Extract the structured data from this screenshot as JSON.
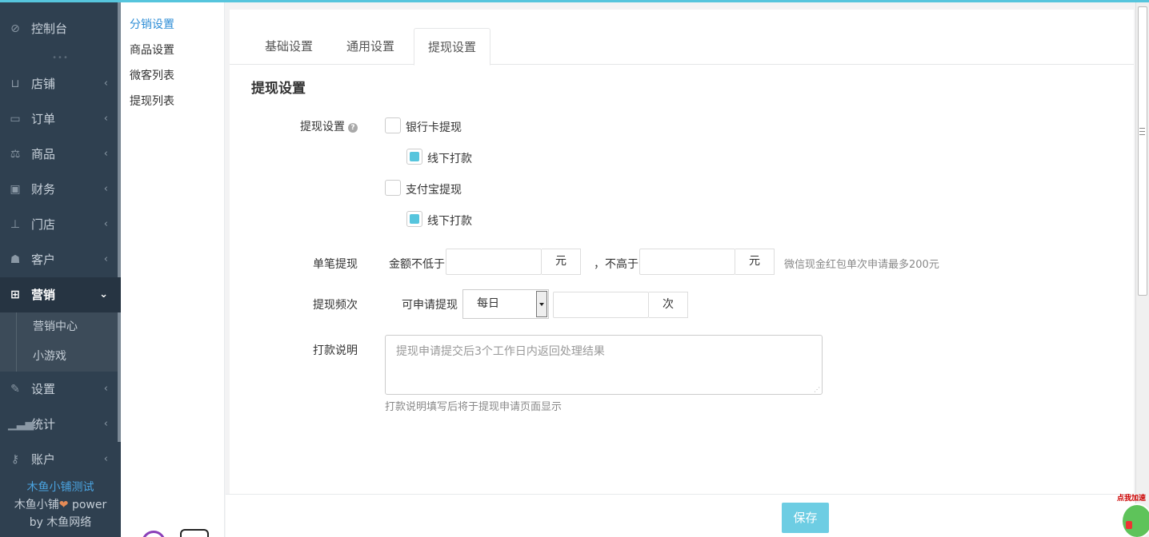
{
  "sidebar": {
    "dashboard": "控制台",
    "items": [
      {
        "label": "店铺",
        "icon": "basket-icon"
      },
      {
        "label": "订单",
        "icon": "money-icon"
      },
      {
        "label": "商品",
        "icon": "scale-icon"
      },
      {
        "label": "财务",
        "icon": "cash-icon"
      },
      {
        "label": "门店",
        "icon": "sitemap-icon"
      },
      {
        "label": "客户",
        "icon": "users-icon"
      },
      {
        "label": "营销",
        "icon": "gift-icon"
      },
      {
        "label": "设置",
        "icon": "wrench-icon"
      },
      {
        "label": "统计",
        "icon": "signal-icon"
      },
      {
        "label": "账户",
        "icon": "key-icon"
      }
    ],
    "marketing_sub": [
      "营销中心",
      "小游戏"
    ],
    "brand_line1": "木鱼小铺测试",
    "brand_line2_a": "木鱼小铺",
    "brand_line2_heart": "❤",
    "brand_line2_b": " power",
    "brand_line3": "by 木鱼网络"
  },
  "submenu": [
    "分销设置",
    "商品设置",
    "微客列表",
    "提现列表"
  ],
  "tabs": [
    "基础设置",
    "通用设置",
    "提现设置"
  ],
  "section_title": "提现设置",
  "form": {
    "withdraw_label": "提现设置",
    "help": "?",
    "bank_card": "银行卡提现",
    "bank_offline": "线下打款",
    "alipay": "支付宝提现",
    "alipay_offline": "线下打款",
    "single_label": "单笔提现",
    "min_prefix": "金额不低于",
    "min_unit": "元",
    "max_prefix": "，不高于",
    "max_unit": "元",
    "single_hint": "微信现金红包单次申请最多200元",
    "freq_label": "提现频次",
    "freq_prefix": "可申请提现",
    "freq_select": "每日",
    "freq_unit": "次",
    "note_label": "打款说明",
    "note_placeholder": "提现申请提交后3个工作日内返回处理结果",
    "note_hint": "打款说明填写后将于提现申请页面显示"
  },
  "save": "保存",
  "badge_text": "点我加速",
  "colors": {
    "accent": "#56c5dd",
    "sidebar_bg": "#2f4050",
    "save": "#6dcde3"
  }
}
